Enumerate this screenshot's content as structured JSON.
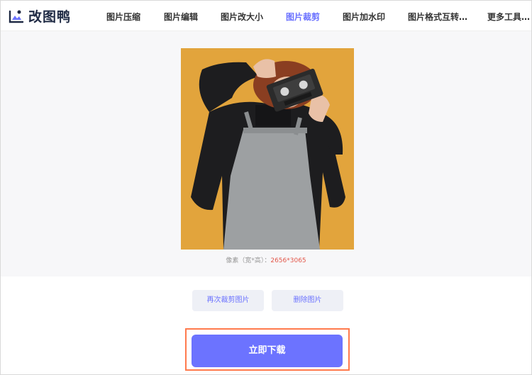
{
  "app": {
    "brand": "改图鸭"
  },
  "nav": {
    "items": [
      {
        "label": "图片压缩"
      },
      {
        "label": "图片编辑"
      },
      {
        "label": "图片改大小"
      },
      {
        "label": "图片裁剪",
        "active": true
      },
      {
        "label": "图片加水印"
      },
      {
        "label": "图片格式互转…"
      },
      {
        "label": "更多工具…"
      }
    ]
  },
  "preview": {
    "caption_label": "像素（宽*高）：",
    "caption_value": "2656*3065"
  },
  "actions": {
    "recrop_label": "再次裁剪图片",
    "delete_label": "删除图片",
    "download_label": "立即下载"
  },
  "colors": {
    "accent": "#6c73ff",
    "highlight_border": "#ff7a4d",
    "photo_background": "#e2a43c"
  }
}
